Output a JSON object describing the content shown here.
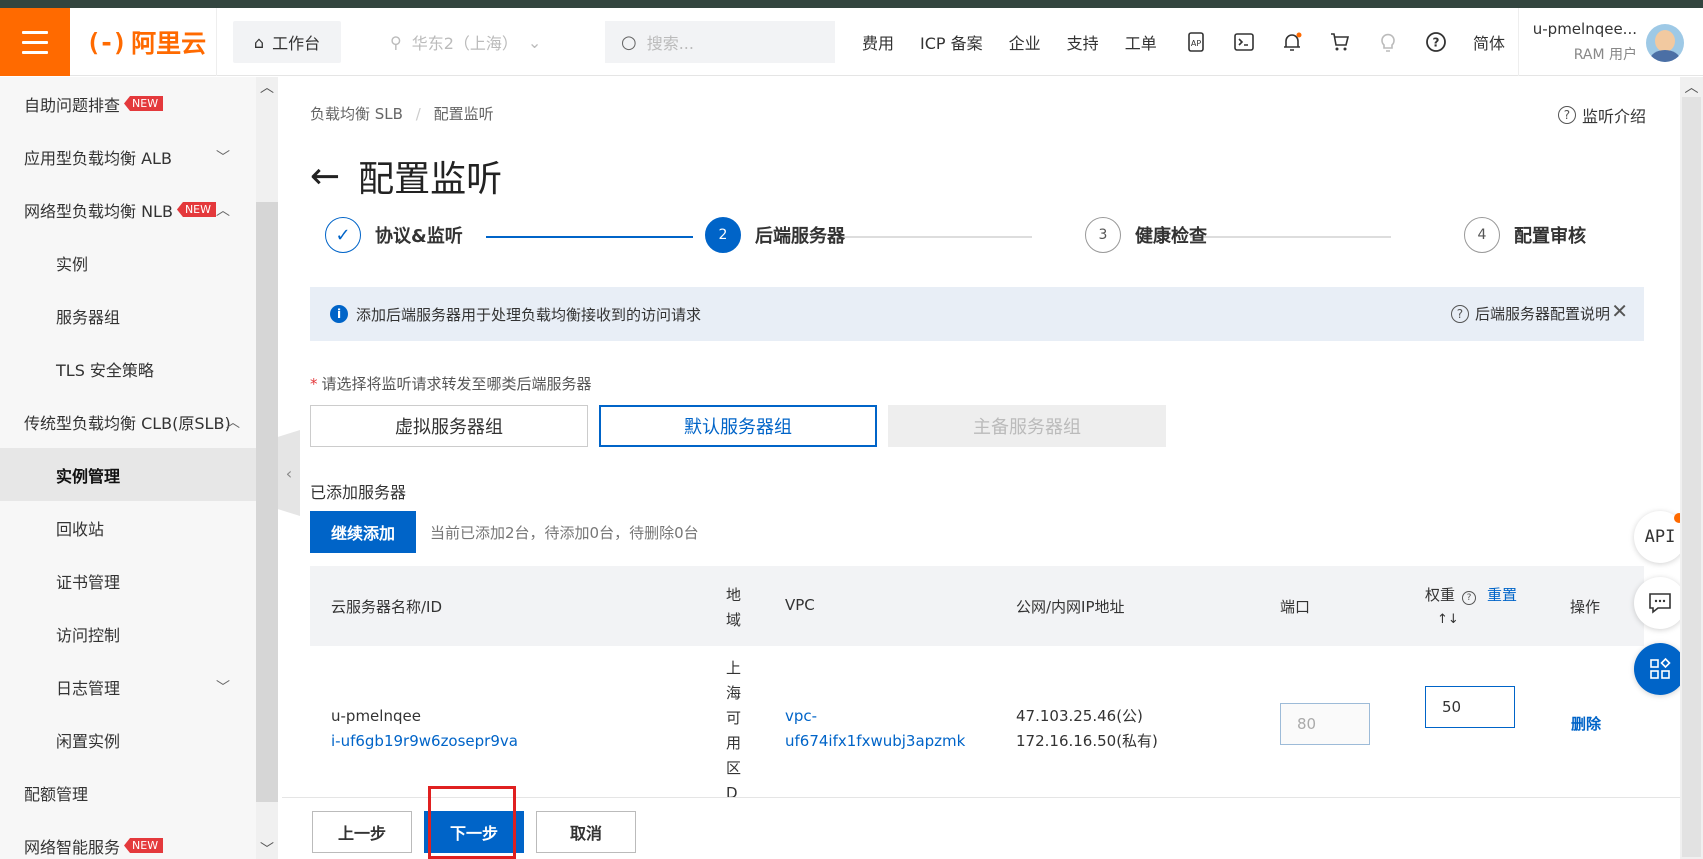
{
  "topbar": {
    "logo_text": "阿里云",
    "logo_mark": "(-)",
    "workbench": "工作台",
    "region": "华东2（上海）",
    "search_placeholder": "搜索...",
    "nav": [
      "费用",
      "ICP 备案",
      "企业",
      "支持",
      "工单"
    ],
    "lang": "简体",
    "user_name": "u-pmelnqee...",
    "user_role": "RAM 用户",
    "icons": [
      "api-doc-icon",
      "terminal-icon",
      "bell-icon",
      "cart-icon",
      "bulb-icon",
      "help-icon"
    ]
  },
  "sidebar": {
    "new_tag": "NEW",
    "items": [
      {
        "label": "自助问题排查",
        "level": "top",
        "new": true
      },
      {
        "label": "应用型负载均衡 ALB",
        "level": "top",
        "chevron": "down"
      },
      {
        "label": "网络型负载均衡 NLB",
        "level": "top",
        "new": true,
        "chevron": "up"
      },
      {
        "label": "实例",
        "level": "sub"
      },
      {
        "label": "服务器组",
        "level": "sub"
      },
      {
        "label": "TLS 安全策略",
        "level": "sub"
      },
      {
        "label": "传统型负载均衡 CLB(原SLB)",
        "level": "top",
        "chevron": "up"
      },
      {
        "label": "实例管理",
        "level": "sub",
        "active": true
      },
      {
        "label": "回收站",
        "level": "sub"
      },
      {
        "label": "证书管理",
        "level": "sub"
      },
      {
        "label": "访问控制",
        "level": "sub"
      },
      {
        "label": "日志管理",
        "level": "sub",
        "chevron": "down"
      },
      {
        "label": "闲置实例",
        "level": "sub"
      },
      {
        "label": "配额管理",
        "level": "top"
      },
      {
        "label": "网络智能服务",
        "level": "top",
        "new": true
      }
    ]
  },
  "breadcrumb": {
    "items": [
      "负载均衡 SLB",
      "配置监听"
    ]
  },
  "help_link": "监听介绍",
  "page_title": "配置监听",
  "steps": [
    {
      "num": "✓",
      "label": "协议&监听",
      "state": "done"
    },
    {
      "num": "2",
      "label": "后端服务器",
      "state": "active"
    },
    {
      "num": "3",
      "label": "健康检查",
      "state": "todo"
    },
    {
      "num": "4",
      "label": "配置审核",
      "state": "todo"
    }
  ],
  "notice": {
    "text": "添加后端服务器用于处理负载均衡接收到的访问请求",
    "right_link": "后端服务器配置说明"
  },
  "server_type": {
    "label": "请选择将监听请求转发至哪类后端服务器",
    "options": [
      "虚拟服务器组",
      "默认服务器组",
      "主备服务器组"
    ],
    "selected": "默认服务器组"
  },
  "added": {
    "label": "已添加服务器",
    "add_button": "继续添加",
    "status": "当前已添加2台，待添加0台，待删除0台"
  },
  "table": {
    "headers": {
      "name": "云服务器名称/ID",
      "region": "地域",
      "vpc": "VPC",
      "ip": "公网/内网IP地址",
      "port": "端口",
      "weight": "权重",
      "reset": "重置",
      "ops": "操作"
    },
    "rows": [
      {
        "name": "u-pmelnqee",
        "id": "i-uf6gb19r9w6zosepr9va",
        "region": "上海可用区D",
        "vpc_line1": "vpc-",
        "vpc_line2": "uf674ifx1fxwubj3apzmk",
        "public_ip": "47.103.25.46(公)",
        "private_ip": "172.16.16.50(私有)",
        "port_placeholder": "80",
        "weight": "50",
        "action": "删除"
      }
    ]
  },
  "footer": {
    "prev": "上一步",
    "next": "下一步",
    "cancel": "取消"
  },
  "floating": {
    "api": "API"
  },
  "colors": {
    "brand_orange": "#ff6a00",
    "primary_blue": "#0064c8",
    "tag_red": "#e4393c"
  }
}
